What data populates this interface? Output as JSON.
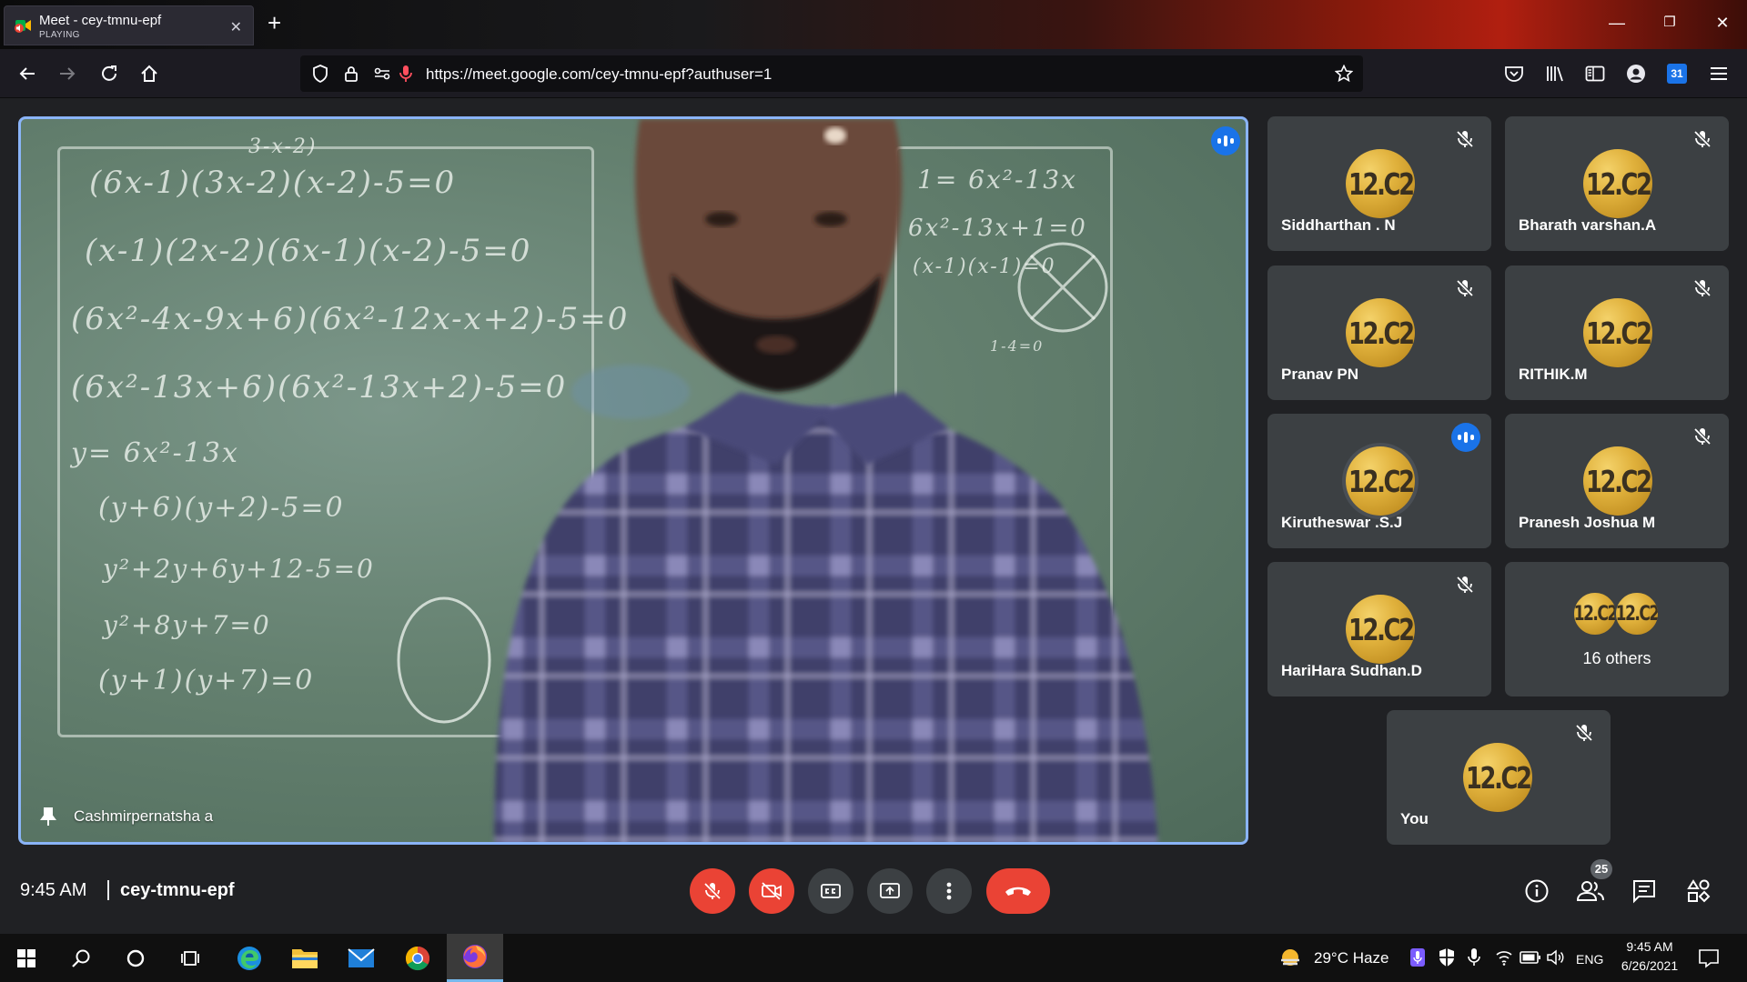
{
  "browser": {
    "tab": {
      "title": "Meet - cey-tmnu-epf",
      "status": "PLAYING"
    },
    "url": "https://meet.google.com/cey-tmnu-epf?authuser=1",
    "calendar_day": "31"
  },
  "meet": {
    "main_tile": {
      "name": "Cashmirpernatsha a"
    },
    "participants": [
      {
        "name": "Siddharthan . N",
        "avatar_text": "12.C2",
        "state": "muted"
      },
      {
        "name": "Bharath varshan.A",
        "avatar_text": "12.C2",
        "state": "muted"
      },
      {
        "name": "Pranav PN",
        "avatar_text": "12.C2",
        "state": "muted"
      },
      {
        "name": "RITHIK.M",
        "avatar_text": "12.C2",
        "state": "muted"
      },
      {
        "name": "Kirutheswar .S.J",
        "avatar_text": "12.C2",
        "state": "speaking"
      },
      {
        "name": "Pranesh Joshua M",
        "avatar_text": "12.C2",
        "state": "muted"
      },
      {
        "name": "HariHara Sudhan.D",
        "avatar_text": "12.C2",
        "state": "muted"
      }
    ],
    "others": {
      "label": "16 others",
      "avatar_text": "12.C2"
    },
    "self_tile": {
      "name": "You",
      "avatar_text": "12.C2"
    },
    "bottom": {
      "time": "9:45 AM",
      "meeting_code": "cey-tmnu-epf",
      "people_count": "25"
    },
    "chalkboard": [
      "3-x-2)",
      "(6x-1)(3x-2)(x-2)-5=0",
      "(x-1)(2x-2)(6x-1)(x-2)-5=0",
      "(6x²-4x-9x+6)(6x²-12x-x+2)-5=0",
      "(6x²-13x+6)(6x²-13x+2)-5=0",
      "y= 6x²-13x",
      "(y+6)(y+2)-5=0",
      "y²+2y+6y+12-5=0",
      "y²+8y+7=0",
      "(y+1)(y+7)=0",
      "1= 6x²-13x",
      "6x²-13x+1=0",
      "(x-1)(x-1)=0",
      "1-4=0"
    ]
  },
  "taskbar": {
    "weather": "29°C  Haze",
    "lang": "ENG",
    "clock_time": "9:45 AM",
    "clock_date": "6/26/2021"
  },
  "colors": {
    "meet_bg": "#202124",
    "tile_bg": "#3c4043",
    "active_border": "#8ab4f8",
    "danger": "#ea4335",
    "speaking": "#1a73e8"
  }
}
